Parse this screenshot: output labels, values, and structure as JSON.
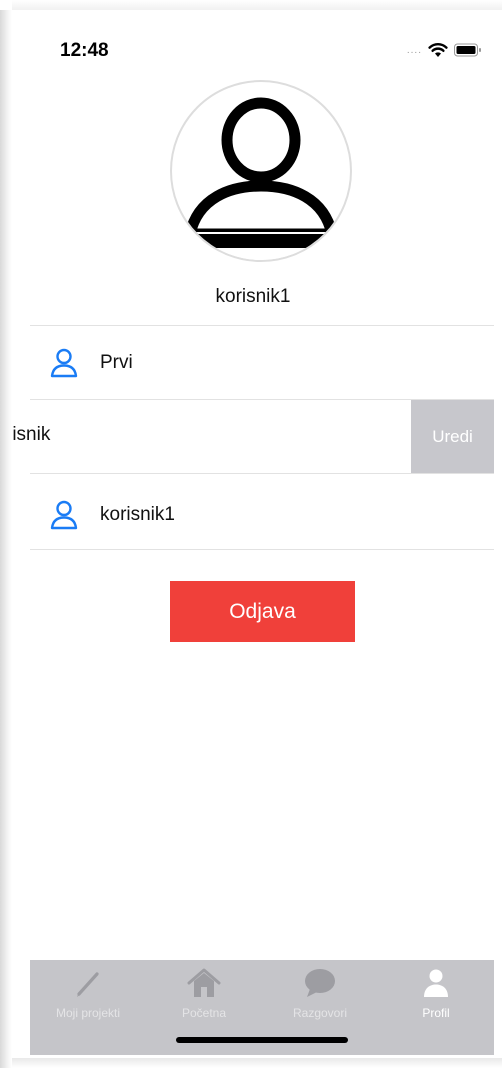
{
  "status_bar": {
    "time": "12:48",
    "signal": "....",
    "wifi_icon": "wifi-icon",
    "battery_icon": "battery-icon"
  },
  "profile": {
    "avatar_icon": "person-placeholder-icon",
    "username": "korisnik1"
  },
  "rows": [
    {
      "icon": "person-outline-icon",
      "label": "Prvi"
    },
    {
      "label": "risnik",
      "action_label": "Uredi"
    },
    {
      "icon": "person-outline-icon",
      "label": "korisnik1"
    }
  ],
  "logout_label": "Odjava",
  "tabbar": {
    "tabs": [
      {
        "icon": "pencil-icon",
        "label": "Moji projekti",
        "active": false
      },
      {
        "icon": "house-icon",
        "label": "Početna",
        "active": false
      },
      {
        "icon": "speech-bubble-icon",
        "label": "Razgovori",
        "active": false
      },
      {
        "icon": "person-icon",
        "label": "Profil",
        "active": true
      }
    ]
  },
  "colors": {
    "accent_blue": "#1a7cf5",
    "logout_red": "#f0403a",
    "swipe_action_gray": "#c7c7cc",
    "tabbar_gray": "#c5c5c9"
  }
}
